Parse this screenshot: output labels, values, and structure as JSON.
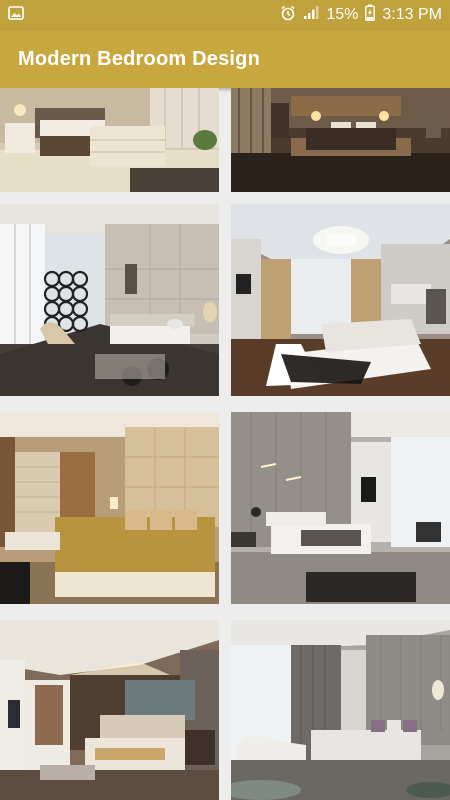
{
  "status_bar": {
    "battery_percent": "15%",
    "time": "3:13 PM",
    "icons": [
      "gallery-notification-icon",
      "alarm-icon",
      "signal-icon",
      "battery-charging-icon"
    ]
  },
  "app_bar": {
    "title": "Modern Bedroom Design",
    "background_color": "#c8a83e",
    "status_color": "#c0a23c"
  },
  "gallery": {
    "items": [
      {
        "name": "bedroom-thumbnail-1"
      },
      {
        "name": "bedroom-thumbnail-2"
      },
      {
        "name": "bedroom-thumbnail-3"
      },
      {
        "name": "bedroom-thumbnail-4"
      },
      {
        "name": "bedroom-thumbnail-5"
      },
      {
        "name": "bedroom-thumbnail-6"
      },
      {
        "name": "bedroom-thumbnail-7"
      },
      {
        "name": "bedroom-thumbnail-8"
      }
    ]
  }
}
